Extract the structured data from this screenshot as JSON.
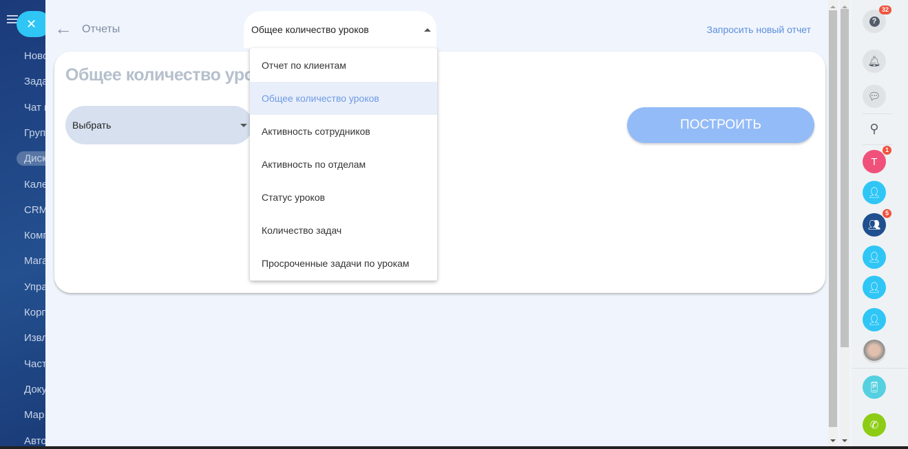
{
  "nav": {
    "items": [
      "Ново",
      "Зада",
      "Чат и",
      "Груп",
      "Диск",
      "Кале",
      "CRM",
      "Комп",
      "Мага",
      "Упра",
      "Корп",
      "Извл",
      "Част",
      "Доку",
      "Мар",
      "Авто"
    ],
    "active_index": 4
  },
  "topbar": {
    "breadcrumb": "Отчеты",
    "selected_report": "Общее количество уроков",
    "request_new": "Запросить новый отчет"
  },
  "card": {
    "title": "Общее количество уроков",
    "picker_placeholder": "Выбрать",
    "build_label": "ПОСТРОИТЬ"
  },
  "menu": {
    "items": [
      "Отчет по клиентам",
      "Общее количество уроков",
      "Активность сотрудников",
      "Активность по отделам",
      "Статус уроков",
      "Количество задач",
      "Просроченные задачи по урокам"
    ],
    "selected_index": 1
  },
  "right_panel": {
    "help_badge": "32",
    "user_t_letter": "T",
    "user_t_badge": "1",
    "group_chat_badge": "5"
  },
  "colors": {
    "accent": "#2fc6f6",
    "build_button": "#93bbf7",
    "link": "#5b8fdd",
    "badge": "#f0533e",
    "call": "#8dcc15"
  }
}
